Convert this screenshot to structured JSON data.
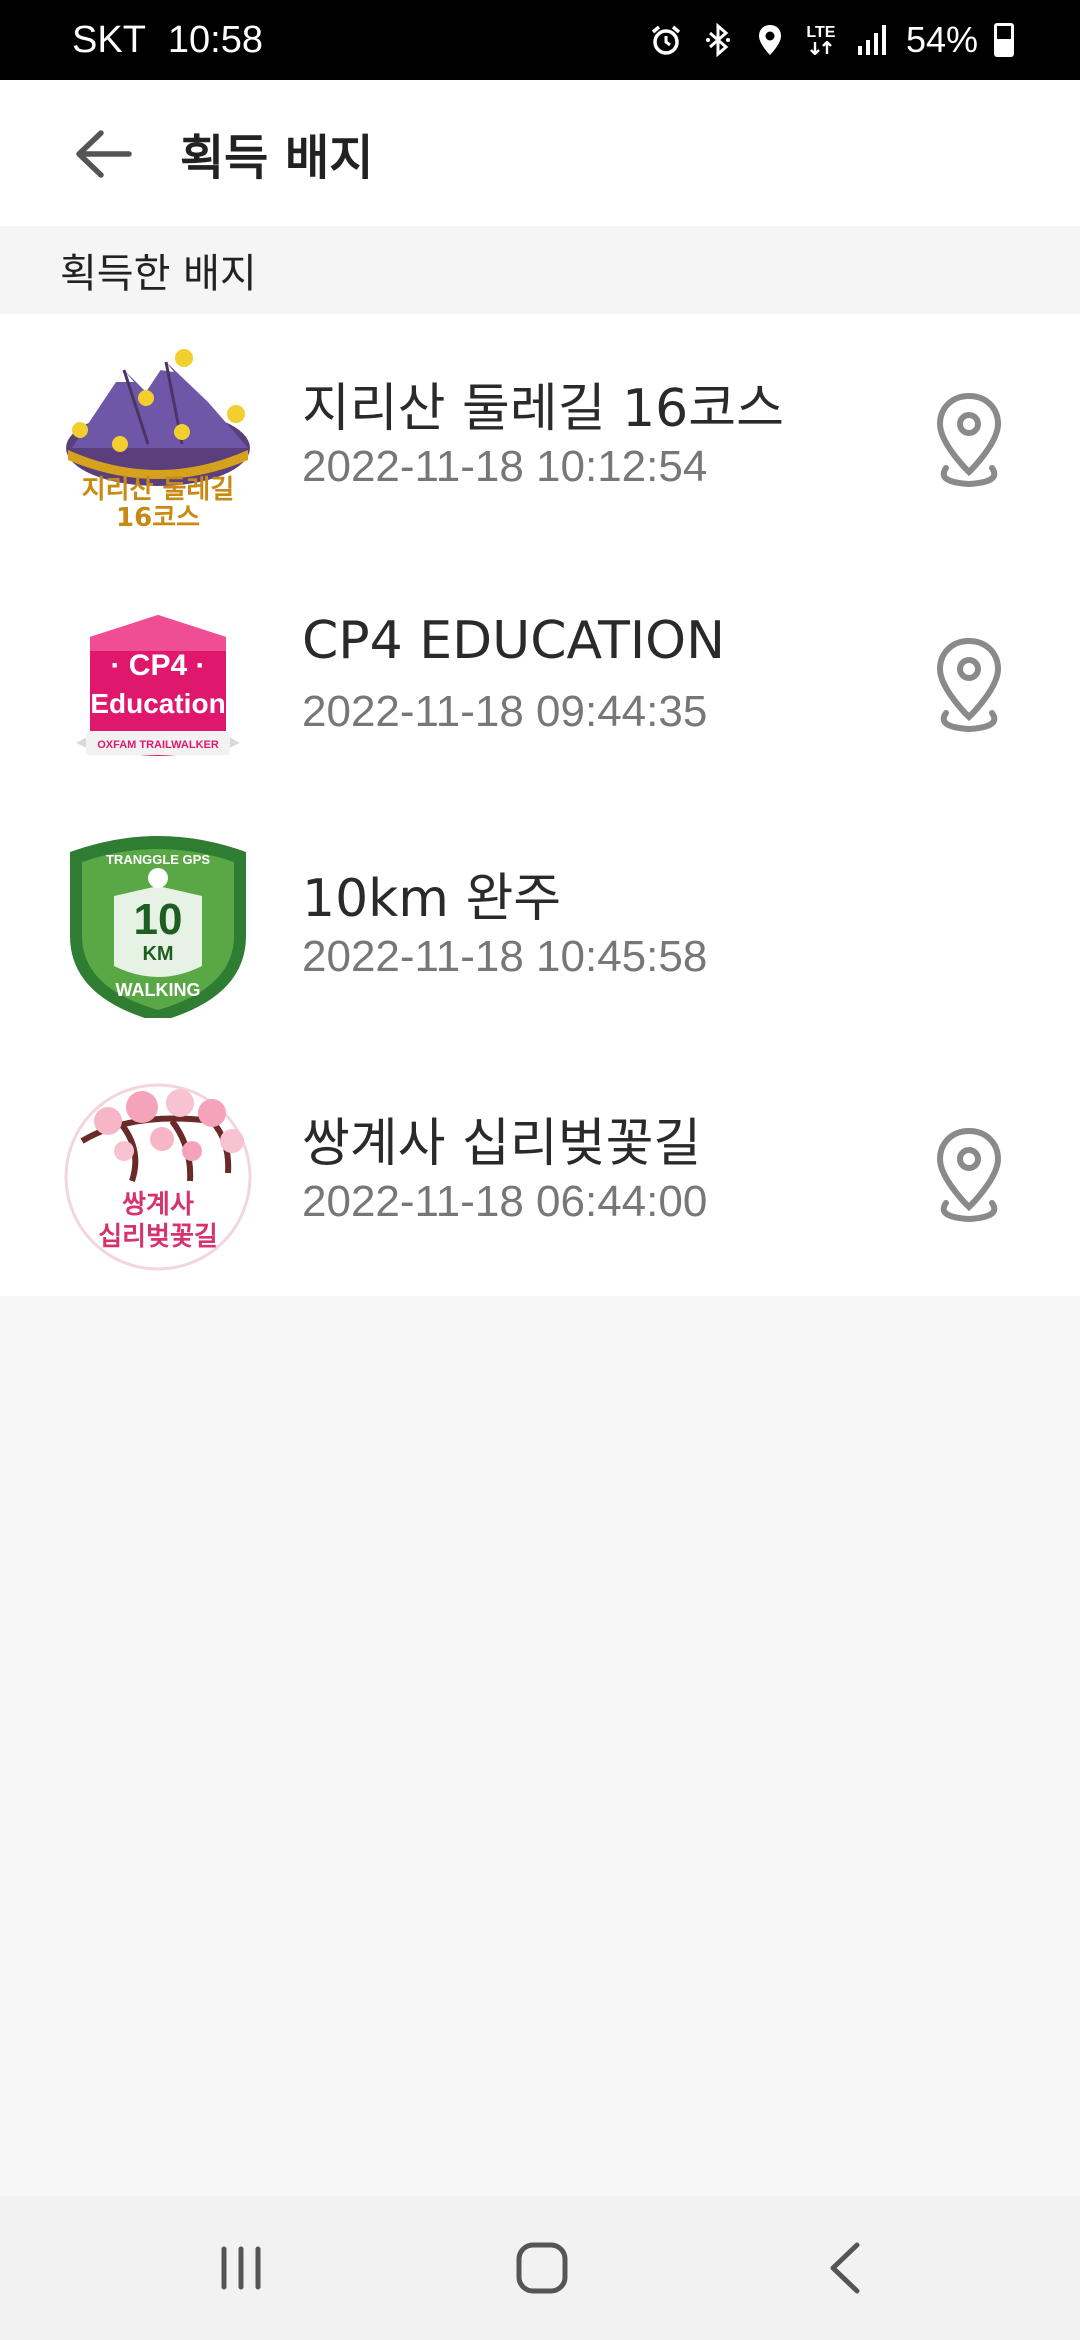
{
  "status_bar": {
    "carrier": "SKT",
    "time": "10:58",
    "network": "LTE",
    "battery": "54%",
    "battery_level": 0.54,
    "icons": [
      "alarm-icon",
      "bluetooth-icon",
      "location-icon",
      "lte-icon",
      "signal-icon",
      "battery-icon"
    ]
  },
  "header": {
    "title": "획득 배지",
    "back_icon": "arrow-left-icon"
  },
  "section": {
    "label": "획득한 배지"
  },
  "badges": [
    {
      "title": "지리산 둘레길 16코스",
      "date": "2022-11-18 10:12:54",
      "badge_text_1": "지리산 둘레길",
      "badge_text_2": "16코스",
      "has_location": true
    },
    {
      "title": "CP4 EDUCATION",
      "date": "2022-11-18 09:44:35",
      "badge_text_1": "· CP4 ·",
      "badge_text_2": "Education",
      "badge_text_3": "OXFAM TRAILWALKER",
      "has_location": true
    },
    {
      "title": "10km 완주",
      "date": "2022-11-18 10:45:58",
      "badge_text_1": "TRANGGLE GPS",
      "badge_text_2": "10",
      "badge_text_3": "KM",
      "badge_text_4": "WALKING",
      "has_location": false
    },
    {
      "title": "쌍계사 십리벚꽃길",
      "date": "2022-11-18 06:44:00",
      "badge_text_1": "쌍계사",
      "badge_text_2": "십리벚꽃길",
      "has_location": true
    }
  ],
  "colors": {
    "status_bar_bg": "#000000",
    "header_bg": "#ffffff",
    "section_bg": "#f5f5f5",
    "page_bg": "#f7f7f7",
    "title_text": "#222222",
    "date_text": "#777777",
    "pin_icon": "#8a8a8a"
  },
  "navbar": {
    "icons": [
      "recent-apps-icon",
      "home-icon",
      "back-icon"
    ]
  }
}
